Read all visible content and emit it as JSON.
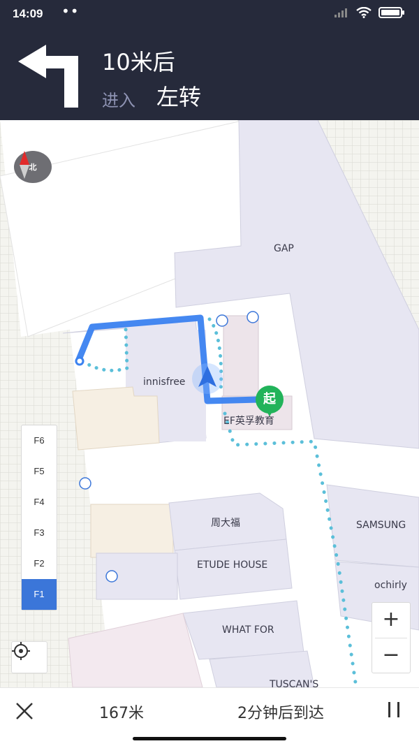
{
  "status_bar": {
    "time": "14:09",
    "dots": "••"
  },
  "navigation": {
    "distance": "10米后",
    "enter_label": "进入",
    "action": "左转"
  },
  "map": {
    "compass_label": "北",
    "store_labels": {
      "gap": "GAP",
      "innisfree": "innisfree",
      "ef": "EF英孚教育",
      "zhoudafu": "周大福",
      "samsung": "SAMSUNG",
      "etude": "ETUDE HOUSE",
      "ochirly": "ochirly",
      "whatfor": "WHAT FOR",
      "tuscans": "TUSCAN'S"
    },
    "start_marker": "起",
    "floors": [
      "F6",
      "F5",
      "F4",
      "F3",
      "F2",
      "F1"
    ],
    "active_floor": "F1",
    "zoom_in": "+",
    "zoom_out": "−"
  },
  "bottom_bar": {
    "remaining_distance": "167米",
    "eta": "2分钟后到达"
  },
  "colors": {
    "header_bg": "#262a3b",
    "route_blue": "#3b82f0",
    "dotted_route": "#5bbfd9",
    "active_floor": "#3b76d9",
    "start_marker": "#22b35a"
  }
}
